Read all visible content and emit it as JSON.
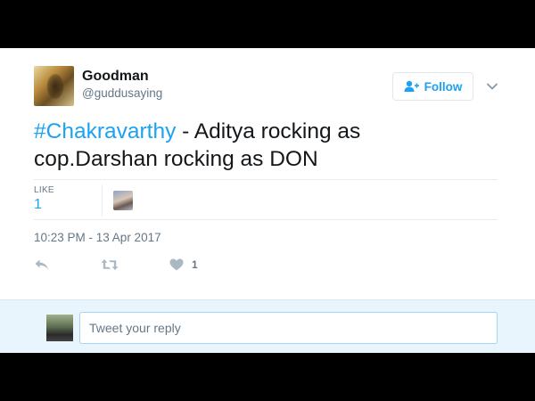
{
  "user": {
    "display_name": "Goodman",
    "screen_name": "@guddusaying"
  },
  "follow_button": {
    "label": "Follow",
    "icon": "follow-person-plus-icon"
  },
  "tweet": {
    "hashtag": "#Chakravarthy",
    "text_line1_rest": " - Aditya rocking as",
    "text_line2": "cop.Darshan rocking as DON"
  },
  "stats": {
    "likes_label": "LIKE",
    "likes_count": "1"
  },
  "timestamp": "10:23 PM - 13 Apr 2017",
  "actions": {
    "reply_icon": "reply-arrow-icon",
    "retweet_icon": "retweet-icon",
    "like_icon": "heart-icon",
    "like_count": "1"
  },
  "reply_box": {
    "placeholder": "Tweet your reply"
  },
  "colors": {
    "accent": "#1da1f2",
    "secondary_text": "#657786",
    "primary_text": "#14171a",
    "reply_bar_bg": "#e8f5fd"
  }
}
